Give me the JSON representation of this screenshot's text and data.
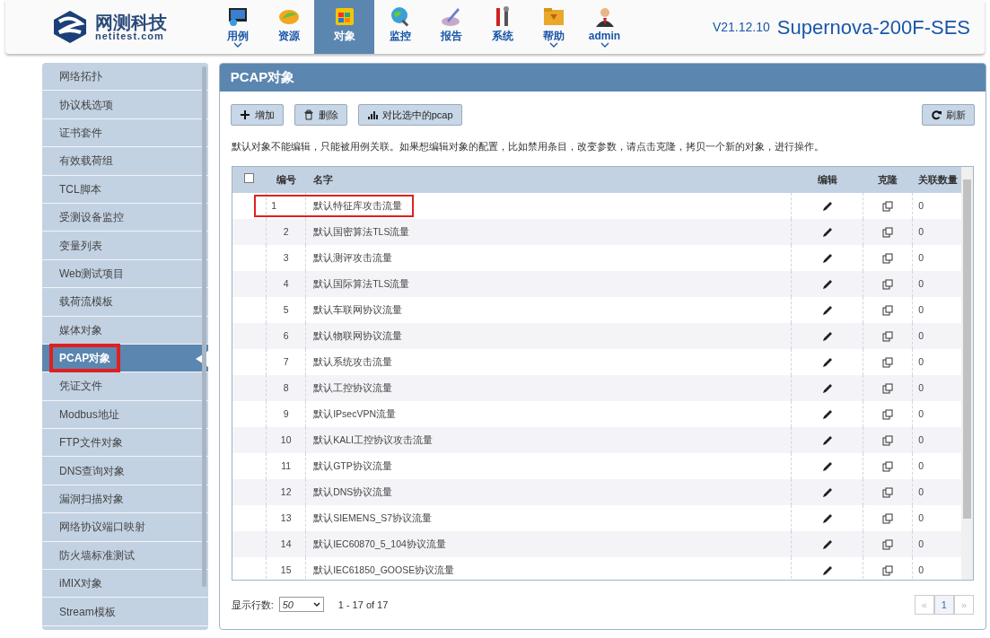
{
  "header": {
    "logo_name": "网测科技",
    "logo_sub": "netitest.com",
    "nav": [
      {
        "label": "用例",
        "dropdown": true,
        "selected": false
      },
      {
        "label": "资源",
        "dropdown": false,
        "selected": false
      },
      {
        "label": "对象",
        "dropdown": false,
        "selected": true
      },
      {
        "label": "监控",
        "dropdown": false,
        "selected": false
      },
      {
        "label": "报告",
        "dropdown": false,
        "selected": false
      },
      {
        "label": "系统",
        "dropdown": false,
        "selected": false
      },
      {
        "label": "帮助",
        "dropdown": true,
        "selected": false
      },
      {
        "label": "admin",
        "dropdown": true,
        "selected": false
      }
    ],
    "version": "V21.12.10",
    "product": "Supernova-200F-SES"
  },
  "sidebar": {
    "items": [
      {
        "label": "网络拓扑",
        "selected": false,
        "annotated": false
      },
      {
        "label": "协议栈选项",
        "selected": false,
        "annotated": false
      },
      {
        "label": "证书套件",
        "selected": false,
        "annotated": false
      },
      {
        "label": "有效载荷组",
        "selected": false,
        "annotated": false
      },
      {
        "label": "TCL脚本",
        "selected": false,
        "annotated": false
      },
      {
        "label": "受测设备监控",
        "selected": false,
        "annotated": false
      },
      {
        "label": "变量列表",
        "selected": false,
        "annotated": false
      },
      {
        "label": "Web测试项目",
        "selected": false,
        "annotated": false
      },
      {
        "label": "载荷流模板",
        "selected": false,
        "annotated": false
      },
      {
        "label": "媒体对象",
        "selected": false,
        "annotated": false
      },
      {
        "label": "PCAP对象",
        "selected": true,
        "annotated": true
      },
      {
        "label": "凭证文件",
        "selected": false,
        "annotated": false
      },
      {
        "label": "Modbus地址",
        "selected": false,
        "annotated": false
      },
      {
        "label": "FTP文件对象",
        "selected": false,
        "annotated": false
      },
      {
        "label": "DNS查询对象",
        "selected": false,
        "annotated": false
      },
      {
        "label": "漏洞扫描对象",
        "selected": false,
        "annotated": false
      },
      {
        "label": "网络协议端口映射",
        "selected": false,
        "annotated": false
      },
      {
        "label": "防火墙标准测试",
        "selected": false,
        "annotated": false
      },
      {
        "label": "iMIX对象",
        "selected": false,
        "annotated": false
      },
      {
        "label": "Stream模板",
        "selected": false,
        "annotated": false
      }
    ]
  },
  "panel": {
    "title": "PCAP对象",
    "toolbar": [
      {
        "label": "增加"
      },
      {
        "label": "删除"
      },
      {
        "label": "对比选中的pcap"
      }
    ],
    "refresh": {
      "label": "刷新"
    },
    "notice": "默认对象不能编辑，只能被用例关联。如果想编辑对象的配置，比如禁用条目，改变参数，请点击克隆，拷贝一个新的对象，进行操作。",
    "table": {
      "select_all_checked": false,
      "columns": [
        "编号",
        "名字",
        "编辑",
        "克隆",
        "关联数量"
      ],
      "rows": [
        {
          "no": "1",
          "name": "默认特征库攻击流量",
          "count": "0",
          "annotated": true
        },
        {
          "no": "2",
          "name": "默认国密算法TLS流量",
          "count": "0",
          "annotated": false
        },
        {
          "no": "3",
          "name": "默认测评攻击流量",
          "count": "0",
          "annotated": false
        },
        {
          "no": "4",
          "name": "默认国际算法TLS流量",
          "count": "0",
          "annotated": false
        },
        {
          "no": "5",
          "name": "默认车联网协议流量",
          "count": "0",
          "annotated": false
        },
        {
          "no": "6",
          "name": "默认物联网协议流量",
          "count": "0",
          "annotated": false
        },
        {
          "no": "7",
          "name": "默认系统攻击流量",
          "count": "0",
          "annotated": false
        },
        {
          "no": "8",
          "name": "默认工控协议流量",
          "count": "0",
          "annotated": false
        },
        {
          "no": "9",
          "name": "默认IPsecVPN流量",
          "count": "0",
          "annotated": false
        },
        {
          "no": "10",
          "name": "默认KALI工控协议攻击流量",
          "count": "0",
          "annotated": false
        },
        {
          "no": "11",
          "name": "默认GTP协议流量",
          "count": "0",
          "annotated": false
        },
        {
          "no": "12",
          "name": "默认DNS协议流量",
          "count": "0",
          "annotated": false
        },
        {
          "no": "13",
          "name": "默认SIEMENS_S7协议流量",
          "count": "0",
          "annotated": false
        },
        {
          "no": "14",
          "name": "默认IEC60870_5_104协议流量",
          "count": "0",
          "annotated": false
        },
        {
          "no": "15",
          "name": "默认IEC61850_GOOSE协议流量",
          "count": "0",
          "annotated": false
        }
      ]
    },
    "footer": {
      "rows_label": "显示行数:",
      "rows_value": "50",
      "range": "1 - 17 of 17",
      "pages": [
        {
          "label": "«",
          "kind": "prev",
          "disabled": true
        },
        {
          "label": "1",
          "kind": "page",
          "disabled": false
        },
        {
          "label": "»",
          "kind": "next",
          "disabled": true
        }
      ]
    }
  }
}
